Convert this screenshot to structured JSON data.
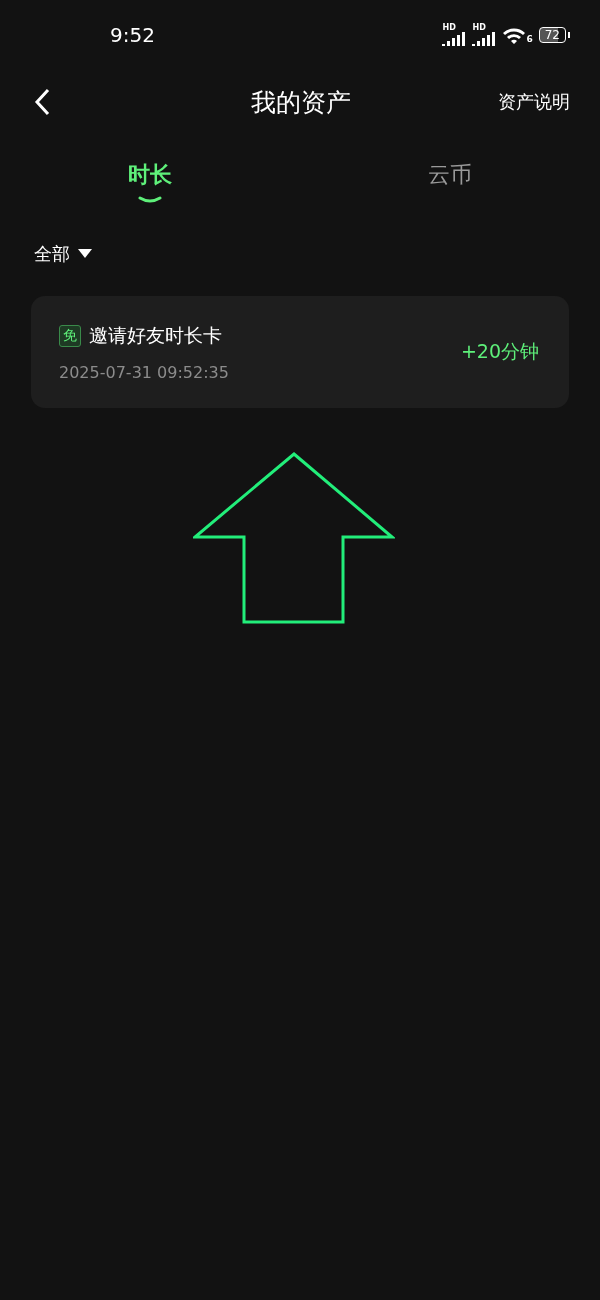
{
  "status_bar": {
    "time": "9:52",
    "signals": [
      {
        "label": "HD"
      },
      {
        "label": "HD"
      }
    ],
    "wifi_label": "6",
    "battery": "72"
  },
  "header": {
    "title": "我的资产",
    "action": "资产说明"
  },
  "tabs": [
    {
      "label": "时长",
      "selected": true
    },
    {
      "label": "云币",
      "selected": false
    }
  ],
  "filter": {
    "label": "全部"
  },
  "records": [
    {
      "badge": "免",
      "title": "邀请好友时长卡",
      "time": "2025-07-31 09:52:35",
      "amount": "+20分钟"
    }
  ],
  "annotation": {
    "kind": "arrow"
  }
}
